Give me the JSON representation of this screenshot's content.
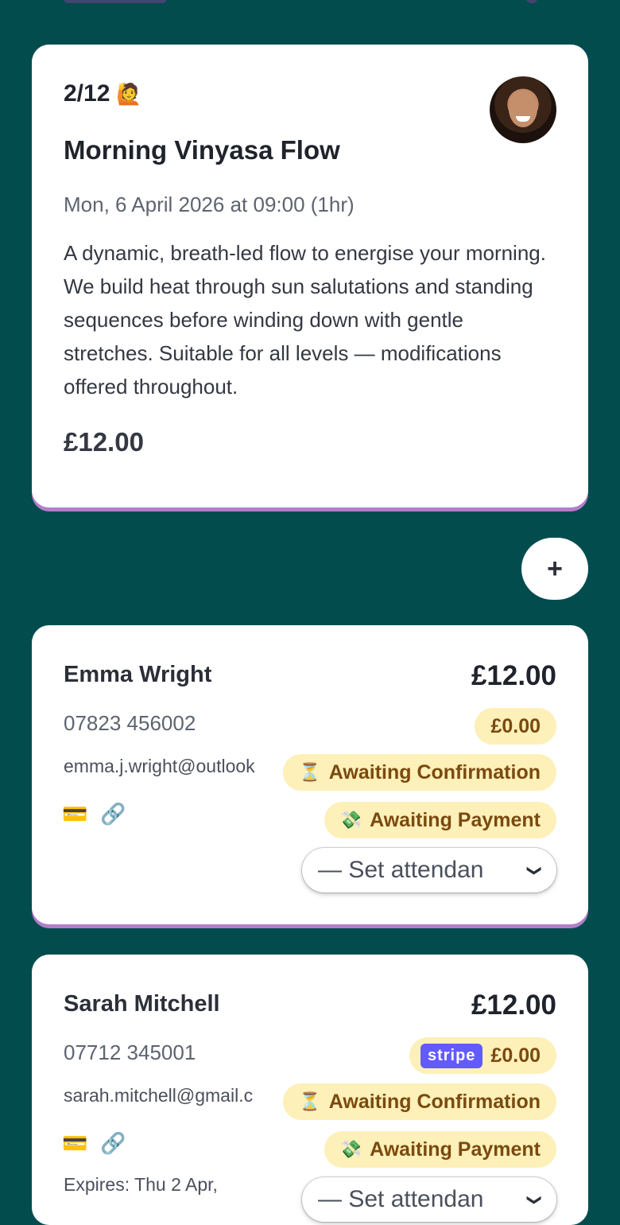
{
  "class_card": {
    "booked_count": "2/12",
    "count_emoji": "🙋",
    "title": "Morning Vinyasa Flow",
    "datetime": "Mon, 6 April 2026 at 09:00 (1hr)",
    "description": "A dynamic, breath-led flow to energise your morning. We build heat through sun salutations and standing sequences before winding down with gentle stretches. Suitable for all levels — modifications offered throughout.",
    "price": "£12.00"
  },
  "add_button_label": "+",
  "bookings": [
    {
      "name": "Emma Wright",
      "phone": "07823 456002",
      "email": "emma.j.wright@outlook",
      "amount": "£12.00",
      "paid": "£0.00",
      "confirmation_status": "Awaiting Confirmation",
      "payment_status": "Awaiting Payment",
      "attendance_select": "— Set attendan",
      "icons": [
        "credit-card-icon",
        "link-icon"
      ]
    },
    {
      "name": "Sarah Mitchell",
      "phone": "07712 345001",
      "email": "sarah.mitchell@gmail.c",
      "amount": "£12.00",
      "paid_provider": "stripe",
      "paid": "£0.00",
      "confirmation_status": "Awaiting Confirmation",
      "payment_status": "Awaiting Payment",
      "expires": "Expires: Thu 2 Apr,",
      "attendance_select": "— Set attendan",
      "icons": [
        "credit-card-icon",
        "link-icon"
      ]
    }
  ],
  "colors": {
    "background": "#024c4e",
    "card": "#ffffff",
    "accent_border": "#b27ec9",
    "pill_bg": "#fdf0b8",
    "pill_text": "#7a4a10",
    "stripe": "#635bff"
  }
}
